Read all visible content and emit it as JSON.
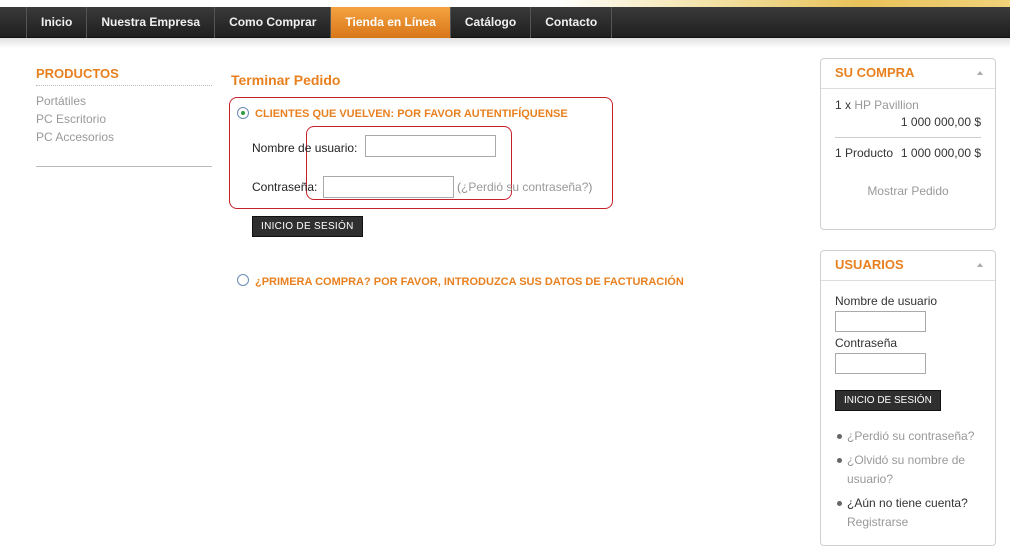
{
  "nav": {
    "items": [
      "Inicio",
      "Nuestra Empresa",
      "Como Comprar",
      "Tienda en Línea",
      "Catálogo",
      "Contacto"
    ],
    "active_index": 3
  },
  "left": {
    "title": "PRODUCTOS",
    "items": [
      "Portátiles",
      "PC Escritorio",
      "PC Accesorios"
    ]
  },
  "main": {
    "title": "Terminar Pedido",
    "returning_label": "CLIENTES QUE VUELVEN: POR FAVOR AUTENTIFÍQUENSE",
    "username_label": "Nombre de usuario:",
    "username_value": "",
    "password_label": "Contraseña:",
    "password_value": "",
    "forgot_open": "(",
    "forgot_link": "¿Perdió su contraseña?",
    "forgot_close": ")",
    "login_button": "INICIO DE SESIÓN",
    "first_purchase_label": "¿PRIMERA COMPRA? POR FAVOR, INTRODUZCA SUS DATOS DE FACTURACIÓN"
  },
  "cart": {
    "title": "SU COMPRA",
    "qty": "1 x",
    "product": "HP Pavillion",
    "price": "1 000 000,00 $",
    "count_label": "1 Producto",
    "total": "1 000 000,00 $",
    "show_order": "Mostrar Pedido"
  },
  "users": {
    "title": "USUARIOS",
    "username_label": "Nombre de usuario",
    "password_label": "Contraseña",
    "login_button": "INICIO DE SESIÓN",
    "forgot_password": "¿Perdió su contraseña?",
    "forgot_username": "¿Olvidó su nombre de usuario?",
    "no_account": "¿Aún no tiene cuenta?",
    "register": "Registrarse"
  }
}
